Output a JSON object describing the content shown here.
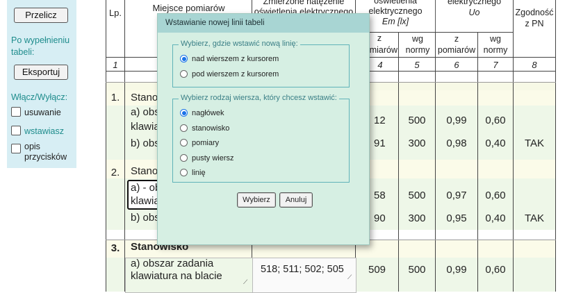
{
  "sidebar": {
    "recalc_button": "Przelicz",
    "after_fill_text": "Po wypełnieniu tabeli:",
    "export_button": "Eksportuj",
    "toggle_label": "Włącz/Wyłącz:",
    "checks": [
      {
        "label": "usuwanie",
        "checked": false
      },
      {
        "label": "wstawiasz",
        "checked": false
      },
      {
        "label": "opis przycisków",
        "checked": false
      }
    ]
  },
  "table": {
    "headers": {
      "lp": "Lp.",
      "place": "Miejsce pomiarów",
      "measured": "Zmierzone natężenie oświetlenia elektrycznego",
      "illum_top": "oświetlenia",
      "illum_mid": "elektrycznego",
      "illum_sym": "Em [lx]",
      "uniform_top": "elektrycznego",
      "uniform_sym": "Uo",
      "compliance": "Zgodność z PN",
      "z_pomiarow": "z pomiarów",
      "wg_normy": "wg normy",
      "z_pomiarow_2": "z pomiarów",
      "wg_normy_2": "wg normy",
      "col_frag_z": "z",
      "col_frag_pomiarow": "miarów"
    },
    "numbers": [
      "1",
      "4",
      "5",
      "6",
      "7",
      "8"
    ],
    "rows": [
      {
        "lp": "1.",
        "name": "Stano",
        "sub_a": "a) obs",
        "sub_a2": "klawia",
        "sub_b": "b) obs",
        "a": {
          "e": "12",
          "norm": "500",
          "u": "0,99",
          "unorm": "0,60",
          "ok": ""
        },
        "b": {
          "e": "91",
          "norm": "300",
          "u": "0,98",
          "unorm": "0,40",
          "ok": "TAK"
        }
      },
      {
        "lp": "2.",
        "name": "Stano",
        "sub_a": "a) - ob",
        "sub_a2": "klawia",
        "sub_b": "b) obs",
        "a": {
          "e": "58",
          "norm": "500",
          "u": "0,97",
          "unorm": "0,60",
          "ok": ""
        },
        "b": {
          "e": "90",
          "norm": "300",
          "u": "0,95",
          "unorm": "0,40",
          "ok": "TAK"
        }
      },
      {
        "lp": "3.",
        "name": "Stanowisko",
        "sub_a": "a) obszar zadania",
        "sub_a2": "klawiatura na blacie",
        "measured": "518; 511; 502; 505",
        "a": {
          "e": "509",
          "norm": "500",
          "u": "0,99",
          "unorm": "0,60",
          "ok": ""
        }
      }
    ]
  },
  "dialog": {
    "title": "Wstawianie nowej linii tabeli",
    "group1_legend": "Wybierz, gdzie wstawić nową linię:",
    "group1_options": [
      {
        "label": "nad wierszem z kursorem",
        "selected": true
      },
      {
        "label": "pod wierszem z kursorem",
        "selected": false
      }
    ],
    "group2_legend": "Wybierz rodzaj wiersza, który chcesz wstawić:",
    "group2_options": [
      {
        "label": "nagłówek",
        "selected": true
      },
      {
        "label": "stanowisko",
        "selected": false
      },
      {
        "label": "pomiary",
        "selected": false
      },
      {
        "label": "pusty wiersz",
        "selected": false
      },
      {
        "label": "linię",
        "selected": false
      }
    ],
    "ok_button": "Wybierz",
    "cancel_button": "Anuluj"
  },
  "colors": {
    "sidebar_bg": "#d7eef4",
    "accent_text": "#1e8c8c",
    "dialog_bg": "#d6efe3",
    "dialog_title_bg": "#a8d5d3",
    "radio_selected": "#1a73e8"
  }
}
